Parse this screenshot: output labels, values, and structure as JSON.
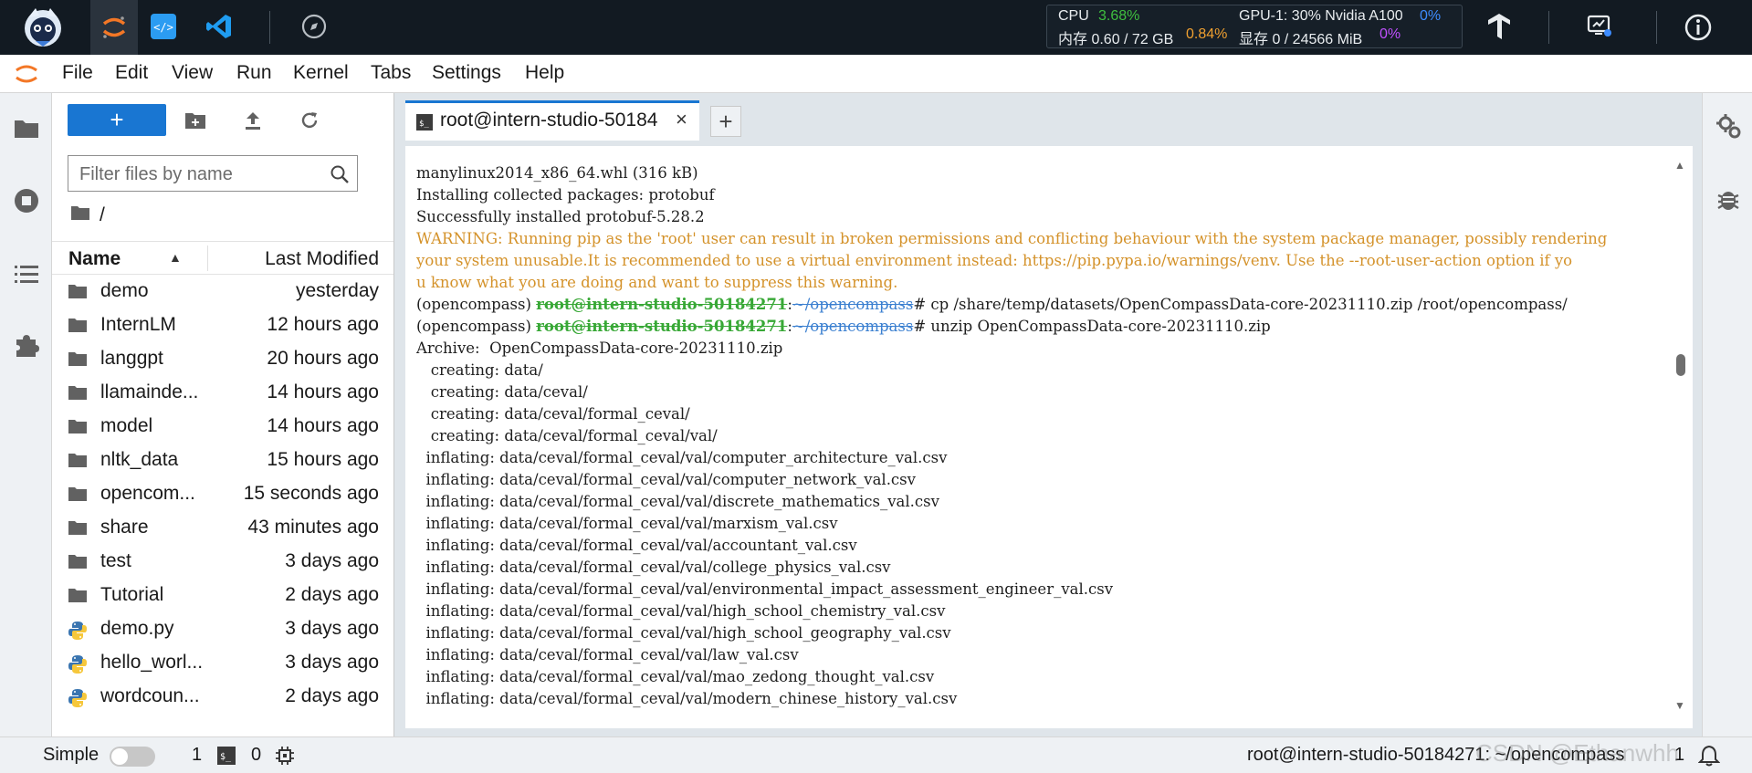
{
  "topbar": {
    "monitor": {
      "cpu_label": "CPU",
      "cpu_value": "3.68%",
      "mem_label": "内存 0.60 / 72 GB",
      "mem_pct": "0.84%",
      "gpu_label": "GPU-1: 30% Nvidia A100",
      "gpu_pct": "0%",
      "vram_label": "显存 0 / 24566 MiB",
      "vram_pct": "0%"
    },
    "colors": {
      "green": "#3fbf3f",
      "orange": "#f0a030",
      "blue": "#3d8cff",
      "magenta": "#c050ff"
    }
  },
  "menu": {
    "items": [
      "File",
      "Edit",
      "View",
      "Run",
      "Kernel",
      "Tabs",
      "Settings",
      "Help"
    ]
  },
  "filebrowser": {
    "new_label": "+",
    "search_placeholder": "Filter files by name",
    "breadcrumb": "/",
    "col_name": "Name",
    "col_modified": "Last Modified",
    "files": [
      {
        "name": "demo",
        "modified": "yesterday",
        "type": "folder"
      },
      {
        "name": "InternLM",
        "modified": "12 hours ago",
        "type": "folder"
      },
      {
        "name": "langgpt",
        "modified": "20 hours ago",
        "type": "folder"
      },
      {
        "name": "llamainde...",
        "modified": "14 hours ago",
        "type": "folder"
      },
      {
        "name": "model",
        "modified": "14 hours ago",
        "type": "folder"
      },
      {
        "name": "nltk_data",
        "modified": "15 hours ago",
        "type": "folder"
      },
      {
        "name": "opencom...",
        "modified": "15 seconds ago",
        "type": "folder"
      },
      {
        "name": "share",
        "modified": "43 minutes ago",
        "type": "folder"
      },
      {
        "name": "test",
        "modified": "3 days ago",
        "type": "folder"
      },
      {
        "name": "Tutorial",
        "modified": "2 days ago",
        "type": "folder"
      },
      {
        "name": "demo.py",
        "modified": "3 days ago",
        "type": "python"
      },
      {
        "name": "hello_worl...",
        "modified": "3 days ago",
        "type": "python"
      },
      {
        "name": "wordcoun...",
        "modified": "2 days ago",
        "type": "python"
      }
    ]
  },
  "terminal": {
    "tab_label": "root@intern-studio-50184",
    "tab_close": "×",
    "add_tab": "+",
    "prompt_env": "(opencompass) ",
    "prompt_user": "root@intern-studio-50184271",
    "prompt_colon": ":",
    "prompt_path": "~/opencompass",
    "prompt_hash": "# ",
    "lines": [
      {
        "kind": "plain",
        "text": "manylinux2014_x86_64.whl (316 kB)"
      },
      {
        "kind": "plain",
        "text": "Installing collected packages: protobuf"
      },
      {
        "kind": "plain",
        "text": "Successfully installed protobuf-5.28.2"
      },
      {
        "kind": "warn",
        "text": "WARNING: Running pip as the 'root' user can result in broken permissions and conflicting behaviour with the system package manager, possibly rendering"
      },
      {
        "kind": "warn",
        "text": "your system unusable.It is recommended to use a virtual environment instead: https://pip.pypa.io/warnings/venv. Use the --root-user-action option if yo"
      },
      {
        "kind": "warn",
        "text": "u know what you are doing and want to suppress this warning."
      },
      {
        "kind": "prompt",
        "text": "cp /share/temp/datasets/OpenCompassData-core-20231110.zip /root/opencompass/"
      },
      {
        "kind": "prompt",
        "text": "unzip OpenCompassData-core-20231110.zip"
      },
      {
        "kind": "plain",
        "text": "Archive:  OpenCompassData-core-20231110.zip"
      },
      {
        "kind": "plain",
        "text": "   creating: data/"
      },
      {
        "kind": "plain",
        "text": "   creating: data/ceval/"
      },
      {
        "kind": "plain",
        "text": "   creating: data/ceval/formal_ceval/"
      },
      {
        "kind": "plain",
        "text": "   creating: data/ceval/formal_ceval/val/"
      },
      {
        "kind": "plain",
        "text": "  inflating: data/ceval/formal_ceval/val/computer_architecture_val.csv"
      },
      {
        "kind": "plain",
        "text": "  inflating: data/ceval/formal_ceval/val/computer_network_val.csv"
      },
      {
        "kind": "plain",
        "text": "  inflating: data/ceval/formal_ceval/val/discrete_mathematics_val.csv"
      },
      {
        "kind": "plain",
        "text": "  inflating: data/ceval/formal_ceval/val/marxism_val.csv"
      },
      {
        "kind": "plain",
        "text": "  inflating: data/ceval/formal_ceval/val/accountant_val.csv"
      },
      {
        "kind": "plain",
        "text": "  inflating: data/ceval/formal_ceval/val/college_physics_val.csv"
      },
      {
        "kind": "plain",
        "text": "  inflating: data/ceval/formal_ceval/val/environmental_impact_assessment_engineer_val.csv"
      },
      {
        "kind": "plain",
        "text": "  inflating: data/ceval/formal_ceval/val/high_school_chemistry_val.csv"
      },
      {
        "kind": "plain",
        "text": "  inflating: data/ceval/formal_ceval/val/high_school_geography_val.csv"
      },
      {
        "kind": "plain",
        "text": "  inflating: data/ceval/formal_ceval/val/law_val.csv"
      },
      {
        "kind": "plain",
        "text": "  inflating: data/ceval/formal_ceval/val/mao_zedong_thought_val.csv"
      },
      {
        "kind": "plain",
        "text": "  inflating: data/ceval/formal_ceval/val/modern_chinese_history_val.csv"
      }
    ]
  },
  "statusbar": {
    "mode_label": "Simple",
    "kernels_count": "1",
    "terminals_count": "0",
    "right_text": "root@intern-studio-50184271: ~/opencompass",
    "right_count": "1",
    "watermark": "CSDN @Ethanwhh"
  }
}
